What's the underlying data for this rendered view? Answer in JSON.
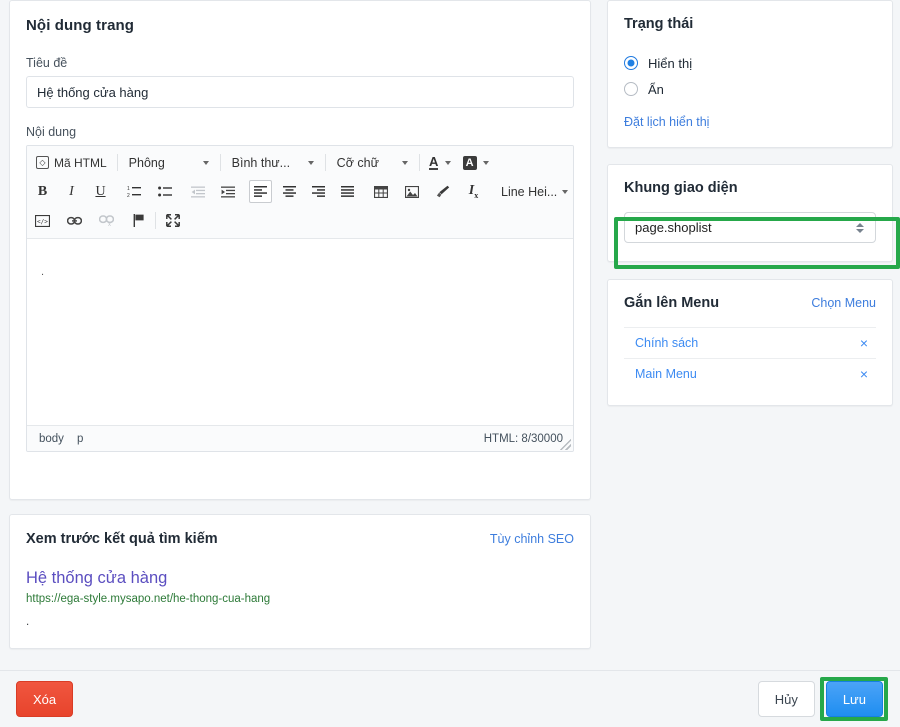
{
  "page": {
    "content_card": {
      "title": "Nội dung trang",
      "title_field_label": "Tiêu đề",
      "title_field_value": "Hệ thống cửa hàng",
      "title_field_placeholder": "",
      "content_field_label": "Nội dung",
      "editor_body_text": "."
    },
    "editor": {
      "toolbar_row1": {
        "html_source_label": "Mã HTML",
        "font_label": "Phông",
        "format_label": "Bình thư...",
        "size_label": "Cỡ chữ",
        "text_color_label": "A",
        "bg_color_label": "A"
      },
      "toolbar_row2": {
        "bold": "B",
        "italic": "I",
        "underline": "U",
        "line_height_label": "Line Hei..."
      },
      "status": {
        "path_body": "body",
        "path_p": "p",
        "counter": "HTML: 8/30000"
      }
    },
    "seo_card": {
      "title": "Xem trước kết quả tìm kiếm",
      "customize_link": "Tùy chỉnh SEO",
      "preview_title": "Hệ thống cửa hàng",
      "preview_url": "https://ega-style.mysapo.net/he-thong-cua-hang",
      "preview_description": "."
    }
  },
  "sidebar": {
    "status_card": {
      "title": "Trạng thái",
      "options": [
        {
          "label": "Hiển thị",
          "selected": true
        },
        {
          "label": "Ẩn",
          "selected": false
        }
      ],
      "schedule_link": "Đặt lịch hiển thị"
    },
    "theme_card": {
      "title": "Khung giao diện",
      "selected_template": "page.shoplist",
      "highlight_color": "#26a84a"
    },
    "menu_card": {
      "title": "Gắn lên Menu",
      "choose_link": "Chọn Menu",
      "items": [
        {
          "label": "Chính sách",
          "remove_label": "×"
        },
        {
          "label": "Main Menu",
          "remove_label": "×"
        }
      ]
    }
  },
  "footer": {
    "delete_label": "Xóa",
    "cancel_label": "Hủy",
    "save_label": "Lưu",
    "save_highlight_color": "#26a84a"
  }
}
